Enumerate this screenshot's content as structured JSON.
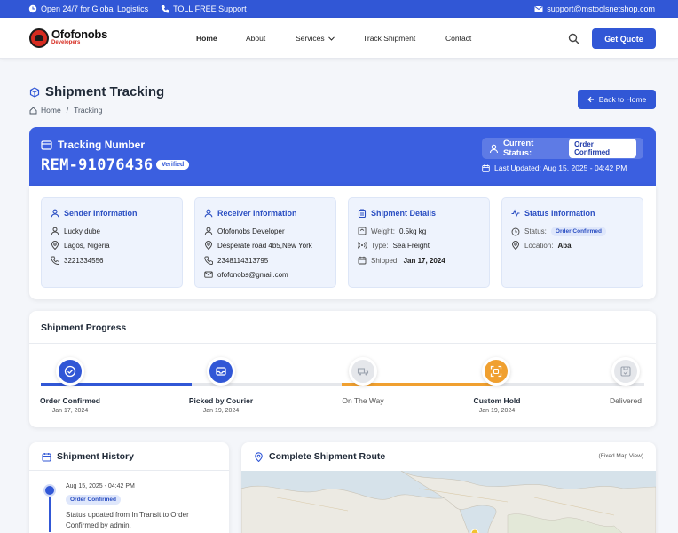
{
  "topbar": {
    "hours": "Open 24/7 for Global Logistics",
    "phone": "TOLL FREE Support",
    "email": "support@mstoolsnetshop.com"
  },
  "nav": {
    "brand": "Ofofonobs",
    "brand_sub": "Developers",
    "items": [
      "Home",
      "About",
      "Services",
      "Track Shipment",
      "Contact"
    ],
    "cta": "Get Quote"
  },
  "page": {
    "title": "Shipment Tracking",
    "breadcrumb": [
      "Home",
      "/",
      "Tracking"
    ],
    "back": "Back to Home"
  },
  "tracking": {
    "label": "Tracking Number",
    "number": "REM-91076436",
    "verified": "Verified",
    "status_label": "Current Status:",
    "status": "Order Confirmed",
    "last_updated": "Last Updated: Aug 15, 2025 - 04:42 PM"
  },
  "sender": {
    "title": "Sender Information",
    "name": "Lucky dube",
    "location": "Lagos, Nigeria",
    "phone": "3221334556"
  },
  "receiver": {
    "title": "Receiver Information",
    "name": "Ofofonobs Developer",
    "address": "Desperate road 4b5,New York",
    "phone": "2348114313795",
    "email": "ofofonobs@gmail.com"
  },
  "shipment": {
    "title": "Shipment Details",
    "weight_label": "Weight:",
    "weight": "0.5kg kg",
    "type_label": "Type:",
    "type": "Sea Freight",
    "shipped_label": "Shipped:",
    "shipped": "Jan 17, 2024"
  },
  "status_info": {
    "title": "Status Information",
    "status_label": "Status:",
    "status": "Order Confirmed",
    "location_label": "Location:",
    "location": "Aba"
  },
  "progress": {
    "title": "Shipment Progress",
    "steps": [
      {
        "name": "Order Confirmed",
        "date": "Jan 17, 2024"
      },
      {
        "name": "Picked by Courier",
        "date": "Jan 19, 2024"
      },
      {
        "name": "On The Way",
        "date": ""
      },
      {
        "name": "Custom Hold",
        "date": "Jan 19, 2024"
      },
      {
        "name": "Delivered",
        "date": ""
      }
    ]
  },
  "history": {
    "title": "Shipment History",
    "entry_time": "Aug 15, 2025 - 04:42 PM",
    "entry_status": "Order Confirmed",
    "entry_text": "Status updated from In Transit to Order Confirmed by admin."
  },
  "route": {
    "title": "Complete Shipment Route",
    "note": "(Fixed Map View)"
  },
  "colors": {
    "primary": "#3157d6",
    "hero": "#3b5fe0",
    "hold": "#f0a030",
    "pending": "#e5e7eb"
  }
}
